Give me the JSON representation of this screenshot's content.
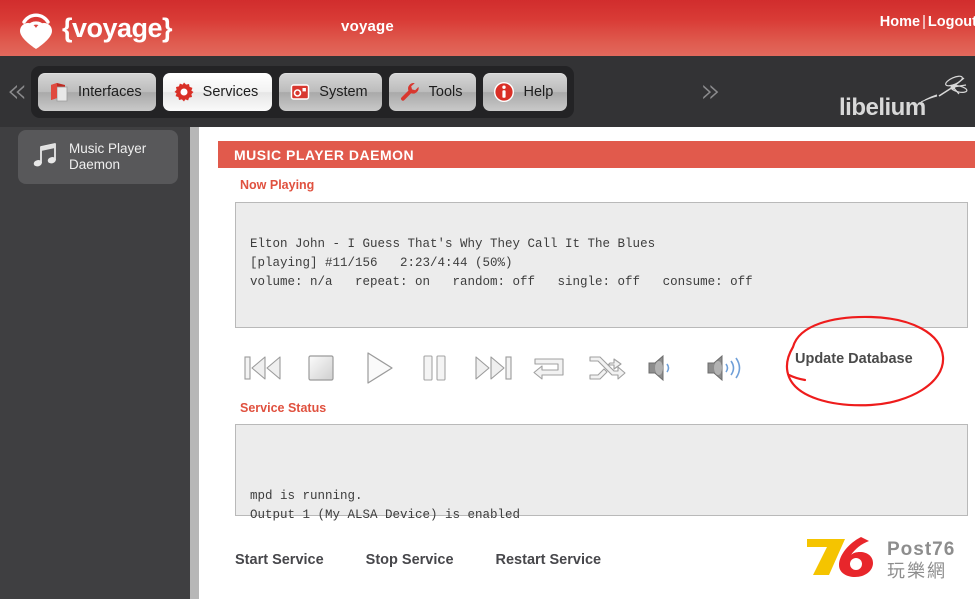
{
  "banner": {
    "logo_text": "{voyage}",
    "logo_icon": "wifi-heart-icon",
    "center_title": "voyage",
    "home_link": "Home",
    "separator": "|",
    "logout_link": "Logout"
  },
  "nav": {
    "chevron_left": "«",
    "chevron_right": "»",
    "items": [
      {
        "label": "Interfaces",
        "icon": "interfaces-icon",
        "active": false
      },
      {
        "label": "Services",
        "icon": "gear-icon",
        "active": true
      },
      {
        "label": "System",
        "icon": "system-icon",
        "active": false
      },
      {
        "label": "Tools",
        "icon": "wrench-icon",
        "active": false
      },
      {
        "label": "Help",
        "icon": "info-icon",
        "active": false
      }
    ],
    "vendor": "libelium",
    "vendor_icon": "mosquito-icon"
  },
  "sidebar": {
    "items": [
      {
        "label_line1": "Music Player",
        "label_line2": "Daemon",
        "icon": "music-note-icon",
        "active": true
      }
    ]
  },
  "main": {
    "page_title": "MUSIC PLAYER DAEMON",
    "now_playing": {
      "label": "Now Playing",
      "line1": "Elton John - I Guess That's Why They Call It The Blues",
      "line2": "[playing] #11/156   2:23/4:44 (50%)",
      "line3": "volume: n/a   repeat: on   random: off   single: off   consume: off"
    },
    "transport": [
      {
        "name": "previous-track-button",
        "icon": "previous-icon"
      },
      {
        "name": "stop-button",
        "icon": "stop-icon"
      },
      {
        "name": "play-button",
        "icon": "play-icon"
      },
      {
        "name": "pause-button",
        "icon": "pause-icon"
      },
      {
        "name": "next-track-button",
        "icon": "next-icon"
      },
      {
        "name": "repeat-button",
        "icon": "repeat-icon"
      },
      {
        "name": "shuffle-button",
        "icon": "shuffle-icon"
      },
      {
        "name": "volume-down-button",
        "icon": "volume-low-icon"
      },
      {
        "name": "volume-up-button",
        "icon": "volume-high-icon"
      }
    ],
    "update_database_label": "Update Database",
    "service_status": {
      "label": "Service Status",
      "line1": "mpd is running.",
      "line2": "Output 1 (My ALSA Device) is enabled"
    },
    "service_buttons": [
      {
        "label": "Start Service"
      },
      {
        "label": "Stop Service"
      },
      {
        "label": "Restart Service"
      }
    ]
  },
  "watermark": {
    "digit_7": "7",
    "digit_6": "6",
    "brand": "Post76",
    "brand_cn": "玩樂網"
  },
  "colors": {
    "banner_top": "#d12d2d",
    "banner_bottom": "#e2695c",
    "nav_bg": "#333335",
    "sidebar_bg": "#3f3f41",
    "title_bar": "#e15a4c",
    "section_label": "#e0513f",
    "panel_bg": "#ececec",
    "annotation": "#ee1c1c",
    "watermark_yellow": "#f5c400",
    "watermark_red": "#e8262b"
  }
}
